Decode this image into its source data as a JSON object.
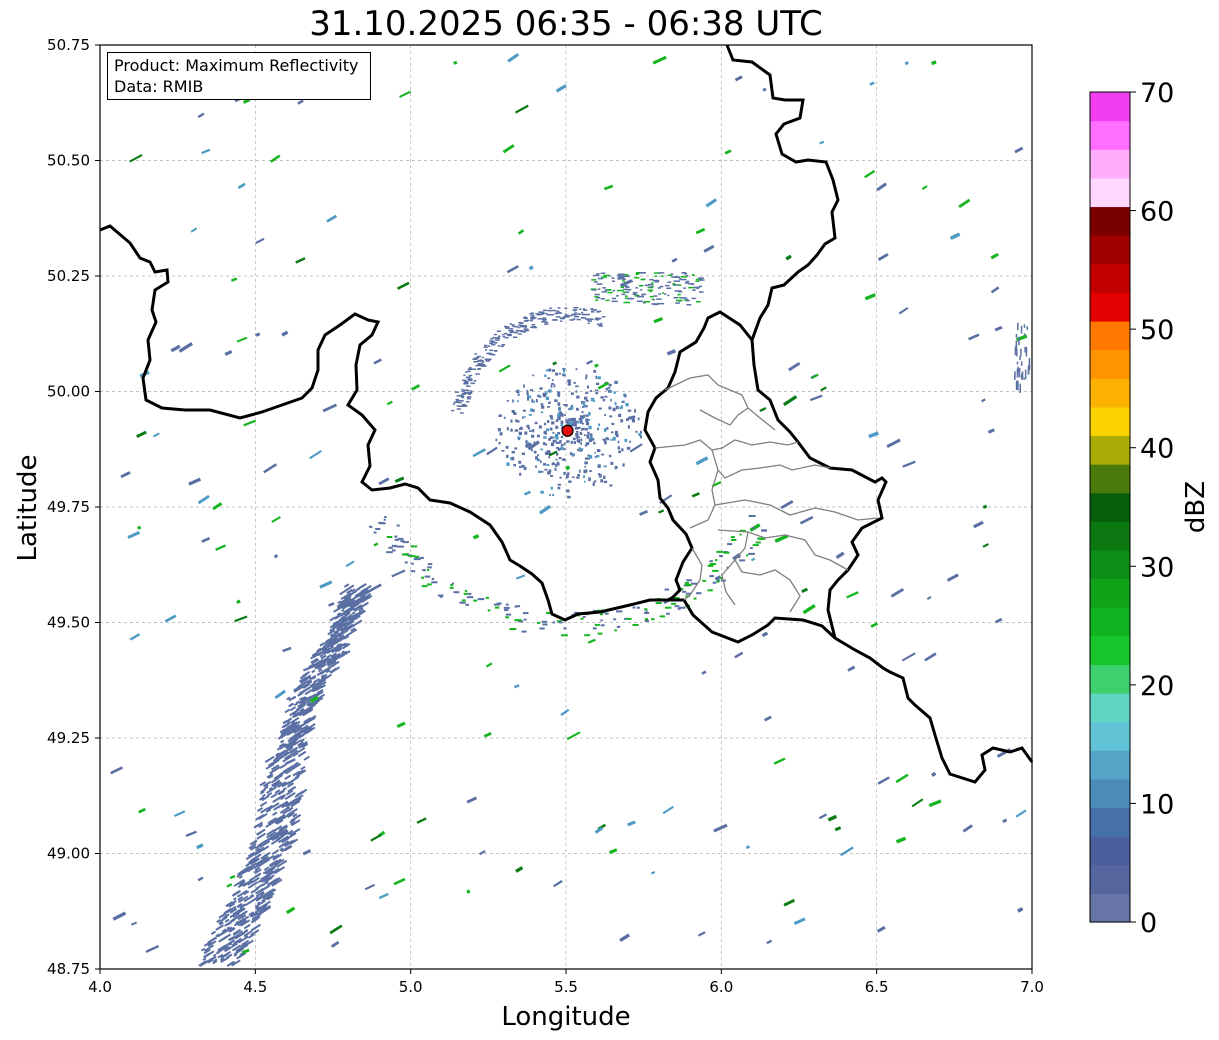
{
  "title": "31.10.2025 06:35 - 06:38 UTC",
  "info": {
    "product": "Product: Maximum Reflectivity",
    "data": "Data: RMIB"
  },
  "xaxis": {
    "label": "Longitude",
    "range": [
      4.0,
      7.0
    ],
    "ticks": [
      4.0,
      4.5,
      5.0,
      5.5,
      6.0,
      6.5,
      7.0
    ],
    "tick_labels": [
      "4.0",
      "4.5",
      "5.0",
      "5.5",
      "6.0",
      "6.5",
      "7.0"
    ]
  },
  "yaxis": {
    "label": "Latitude",
    "range": [
      48.75,
      50.75
    ],
    "ticks": [
      48.75,
      49.0,
      49.25,
      49.5,
      49.75,
      50.0,
      50.25,
      50.5,
      50.75
    ],
    "tick_labels": [
      "48.75",
      "49.00",
      "49.25",
      "49.50",
      "49.75",
      "50.00",
      "50.25",
      "50.50",
      "50.75"
    ]
  },
  "grid": true,
  "radar_site": {
    "lon": 5.505,
    "lat": 49.915,
    "color": "#e01010"
  },
  "colorbar": {
    "label": "dBZ",
    "range": [
      0,
      70
    ],
    "tick_values": [
      0,
      10,
      20,
      30,
      40,
      50,
      60,
      70
    ],
    "tick_labels": [
      "0",
      "10",
      "20",
      "30",
      "40",
      "50",
      "60",
      "70"
    ],
    "colors": [
      "#6675a6",
      "#55679e",
      "#4a5f9c",
      "#4670a8",
      "#4c8ab8",
      "#55a5c8",
      "#62c2d6",
      "#5fd6c2",
      "#3dd06e",
      "#18c52c",
      "#12b320",
      "#0fa31a",
      "#0e8e16",
      "#0b7812",
      "#075f0c",
      "#4a7b0c",
      "#a8aa06",
      "#fad200",
      "#fdb100",
      "#fe9500",
      "#ff7800",
      "#e30000",
      "#c20000",
      "#a00000",
      "#7a0000",
      "#ffd7ff",
      "#ffaefe",
      "#ff6efe",
      "#f03ef0"
    ]
  },
  "borders": {
    "color": "#000000",
    "region_color": "#7f7f7f"
  },
  "echo_colors": {
    "weak": "#5a6fa3",
    "mid": "#4d9bc4",
    "strong": "#16b51f",
    "core": "#0c7b14"
  }
}
